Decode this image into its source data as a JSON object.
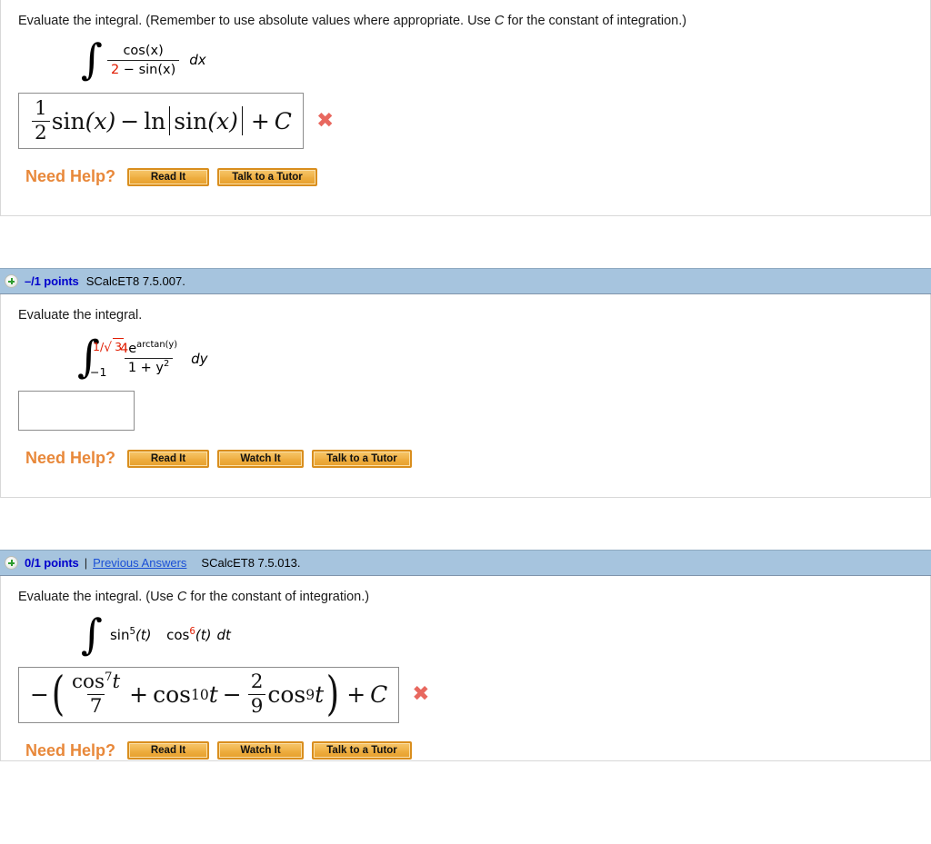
{
  "problems": [
    {
      "id": "p1",
      "header_visible": false,
      "prompt_parts": [
        {
          "text": "Evaluate the integral. (Remember to use absolute values where appropriate. Use ",
          "style": "normal"
        },
        {
          "text": "C",
          "style": "italic"
        },
        {
          "text": " for the constant of integration.)",
          "style": "normal"
        }
      ],
      "integral": {
        "type": "indefinite",
        "numerator": "cos(x)",
        "denominator_coefficient": "2",
        "denominator_rest": " − sin(x)",
        "differential": "dx"
      },
      "answer": {
        "state": "incorrect",
        "latex_text": "1/2 sin(x) − ln|sin(x)| + C",
        "mark": "✖"
      },
      "help": {
        "label": "Need Help?",
        "buttons": [
          "Read It",
          "Talk to a Tutor"
        ]
      }
    },
    {
      "id": "p2",
      "header_visible": true,
      "header": {
        "icon": "plus-circle-icon",
        "points": "–/1 points",
        "separator": "",
        "previous_answers": "",
        "code": "SCalcET8 7.5.007."
      },
      "prompt_parts": [
        {
          "text": "Evaluate the integral.",
          "style": "normal"
        }
      ],
      "integral": {
        "type": "definite",
        "lower_limit": "−1",
        "upper_limit_prefix": "1/",
        "upper_limit_radicand": "3",
        "numerator_coefficient": "4",
        "numerator_base": "e",
        "numerator_exponent": "arctan(y)",
        "denominator": "1 + y",
        "denominator_exponent": "2",
        "differential": "dy"
      },
      "answer": {
        "state": "empty",
        "value": "",
        "mark": ""
      },
      "help": {
        "label": "Need Help?",
        "buttons": [
          "Read It",
          "Watch It",
          "Talk to a Tutor"
        ]
      }
    },
    {
      "id": "p3",
      "header_visible": true,
      "header": {
        "icon": "plus-circle-icon",
        "points": "0/1 points",
        "separator": "|",
        "previous_answers": "Previous Answers",
        "code": "SCalcET8 7.5.013."
      },
      "prompt_parts": [
        {
          "text": "Evaluate the integral. (Use ",
          "style": "normal"
        },
        {
          "text": "C",
          "style": "italic"
        },
        {
          "text": " for the constant of integration.)",
          "style": "normal"
        }
      ],
      "integral": {
        "type": "indefinite",
        "term1_base": "sin",
        "term1_exponent": "5",
        "term1_arg": "(t)",
        "term2_base": "cos",
        "term2_exponent": "6",
        "term2_arg": "(t)",
        "differential": "dt"
      },
      "answer": {
        "state": "incorrect",
        "latex_text": "−( cos⁷t/7 + cos¹⁰t − 2/9 cos⁹t ) + C",
        "mark": "✖"
      },
      "help": {
        "label": "Need Help?",
        "buttons": [
          "Read It",
          "Watch It",
          "Talk to a Tutor"
        ]
      }
    }
  ],
  "math_symbols": {
    "integral": "∫",
    "minus": "−",
    "plus": "+",
    "radical": "√"
  },
  "colors": {
    "header_bar": "#a6c4de",
    "points_text": "#0000cc",
    "link": "#1a4fd6",
    "highlight_red": "#e01b00",
    "x_mark": "#e8685f",
    "help_label": "#e8883a",
    "button_face": "#eead3f"
  },
  "p1_answer_tokens": {
    "frac_num": "1",
    "frac_den": "2",
    "sin1": "sin",
    "arg1": "(x)",
    "minus": "−",
    "ln": "ln",
    "sin2": "sin",
    "arg2": "(x)",
    "plus": "+",
    "C": "C"
  },
  "p3_answer_tokens": {
    "lead_minus": "−",
    "cos1": "cos",
    "exp1": "7",
    "var1": "t",
    "den1": "7",
    "plus": "+",
    "cos2": "cos",
    "exp2": "10",
    "var2": "t",
    "minus": "−",
    "fr_num": "2",
    "fr_den": "9",
    "cos3": "cos",
    "exp3": "9",
    "var3": "t",
    "plus2": "+",
    "C": "C"
  }
}
